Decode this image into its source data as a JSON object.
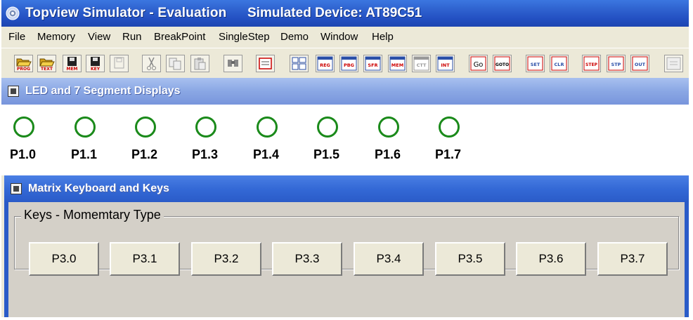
{
  "titlebar": {
    "title": "Topview Simulator - Evaluation",
    "device": "Simulated Device: AT89C51"
  },
  "menu": [
    "File",
    "Memory",
    "View",
    "Run",
    "BreakPoint",
    "SingleStep",
    "Demo",
    "Window",
    "Help"
  ],
  "toolbar": {
    "buttons": [
      {
        "name": "open-prog-icon",
        "label": "PROG"
      },
      {
        "name": "open-text-icon",
        "label": "TEXT"
      },
      {
        "name": "save-mem-icon",
        "label": "MEM"
      },
      {
        "name": "save-ky-icon",
        "label": "KEY"
      },
      {
        "name": "save-disabled-icon",
        "label": ""
      },
      {
        "name": "cut-icon",
        "label": ""
      },
      {
        "name": "copy-icon",
        "label": ""
      },
      {
        "name": "paste-icon",
        "label": ""
      },
      {
        "name": "find-icon",
        "label": ""
      },
      {
        "name": "print-icon",
        "label": ""
      },
      {
        "name": "window-layout-icon",
        "label": ""
      },
      {
        "name": "reg-icon",
        "label": "REG"
      },
      {
        "name": "pbg-icon",
        "label": "PBG"
      },
      {
        "name": "sfr-icon",
        "label": "SFR"
      },
      {
        "name": "mem-icon",
        "label": "MEM"
      },
      {
        "name": "ctt-icon",
        "label": "CTT"
      },
      {
        "name": "int-icon",
        "label": "INT"
      },
      {
        "name": "go-icon",
        "label": "Go"
      },
      {
        "name": "goto-icon",
        "label": "GOTO"
      },
      {
        "name": "set-break-icon",
        "label": "SET"
      },
      {
        "name": "clear-break-icon",
        "label": "CLR"
      },
      {
        "name": "step-icon",
        "label": "STEP"
      },
      {
        "name": "step-over-icon",
        "label": "STP"
      },
      {
        "name": "step-out-icon",
        "label": "OUT"
      },
      {
        "name": "exit-icon",
        "label": ""
      }
    ]
  },
  "led_panel": {
    "title": "LED and 7 Segment Displays",
    "leds": [
      "P1.0",
      "P1.1",
      "P1.2",
      "P1.3",
      "P1.4",
      "P1.5",
      "P1.6",
      "P1.7"
    ],
    "led_color": "#1a8a1a"
  },
  "keyboard_panel": {
    "title": "Matrix Keyboard and Keys",
    "group_label": "Keys - Momemtary Type",
    "keys": [
      "P3.0",
      "P3.1",
      "P3.2",
      "P3.3",
      "P3.4",
      "P3.5",
      "P3.6",
      "P3.7"
    ]
  }
}
